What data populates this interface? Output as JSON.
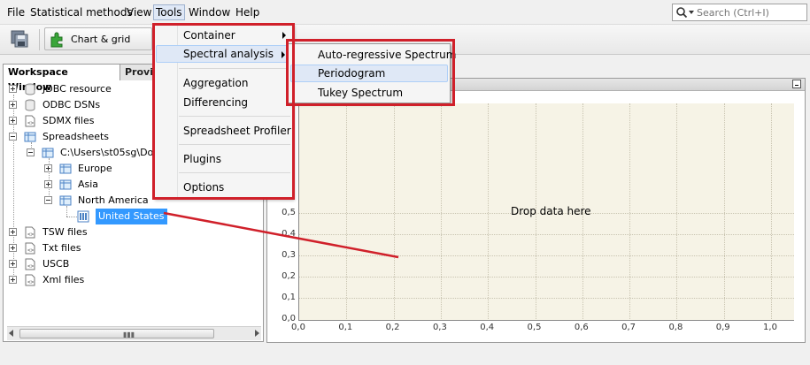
{
  "menubar": {
    "items": [
      "File",
      "Statistical methods",
      "View",
      "Tools",
      "Window",
      "Help"
    ],
    "active": "Tools"
  },
  "search": {
    "placeholder": "Search (Ctrl+I)"
  },
  "toolbar": {
    "chart_grid_label": "Chart & grid"
  },
  "left_panel": {
    "tabs": [
      "Workspace Window",
      "Provid"
    ],
    "tree": [
      {
        "label": "JDBC resource",
        "depth": 0,
        "expander": "plus"
      },
      {
        "label": "ODBC DSNs",
        "depth": 0,
        "expander": "plus"
      },
      {
        "label": "SDMX files",
        "depth": 0,
        "expander": "plus"
      },
      {
        "label": "Spreadsheets",
        "depth": 0,
        "expander": "minus"
      },
      {
        "label": "C:\\Users\\st05sg\\Docu",
        "depth": 1,
        "expander": "minus"
      },
      {
        "label": "Europe",
        "depth": 2,
        "expander": "plus"
      },
      {
        "label": "Asia",
        "depth": 2,
        "expander": "plus"
      },
      {
        "label": "North America",
        "depth": 2,
        "expander": "minus"
      },
      {
        "label": "United States",
        "depth": 3,
        "expander": "none",
        "selected": true
      },
      {
        "label": "TSW files",
        "depth": 0,
        "expander": "plus"
      },
      {
        "label": "Txt files",
        "depth": 0,
        "expander": "plus"
      },
      {
        "label": "USCB",
        "depth": 0,
        "expander": "plus"
      },
      {
        "label": "Xml files",
        "depth": 0,
        "expander": "plus"
      }
    ]
  },
  "tools_menu": {
    "items": [
      "Container",
      "Spectral analysis",
      "Aggregation",
      "Differencing",
      "Spreadsheet Profiler",
      "Plugins",
      "Options"
    ],
    "highlighted": "Spectral analysis"
  },
  "spectral_submenu": {
    "items": [
      "Auto-regressive Spectrum",
      "Periodogram",
      "Tukey Spectrum"
    ],
    "highlighted": "Periodogram"
  },
  "chart": {
    "drop_hint": "Drop data here",
    "y_ticks": [
      "0,0",
      "0,1",
      "0,2",
      "0,3",
      "0,4",
      "0,5"
    ],
    "x_ticks": [
      "0,0",
      "0,1",
      "0,2",
      "0,3",
      "0,4",
      "0,5",
      "0,6",
      "0,7",
      "0,8",
      "0,9",
      "1,0"
    ]
  },
  "colors": {
    "annotation_red": "#d0202a",
    "selection_blue": "#3399ff",
    "chart_background": "#f6f3e6",
    "menu_highlight": "#dfe8f6"
  }
}
